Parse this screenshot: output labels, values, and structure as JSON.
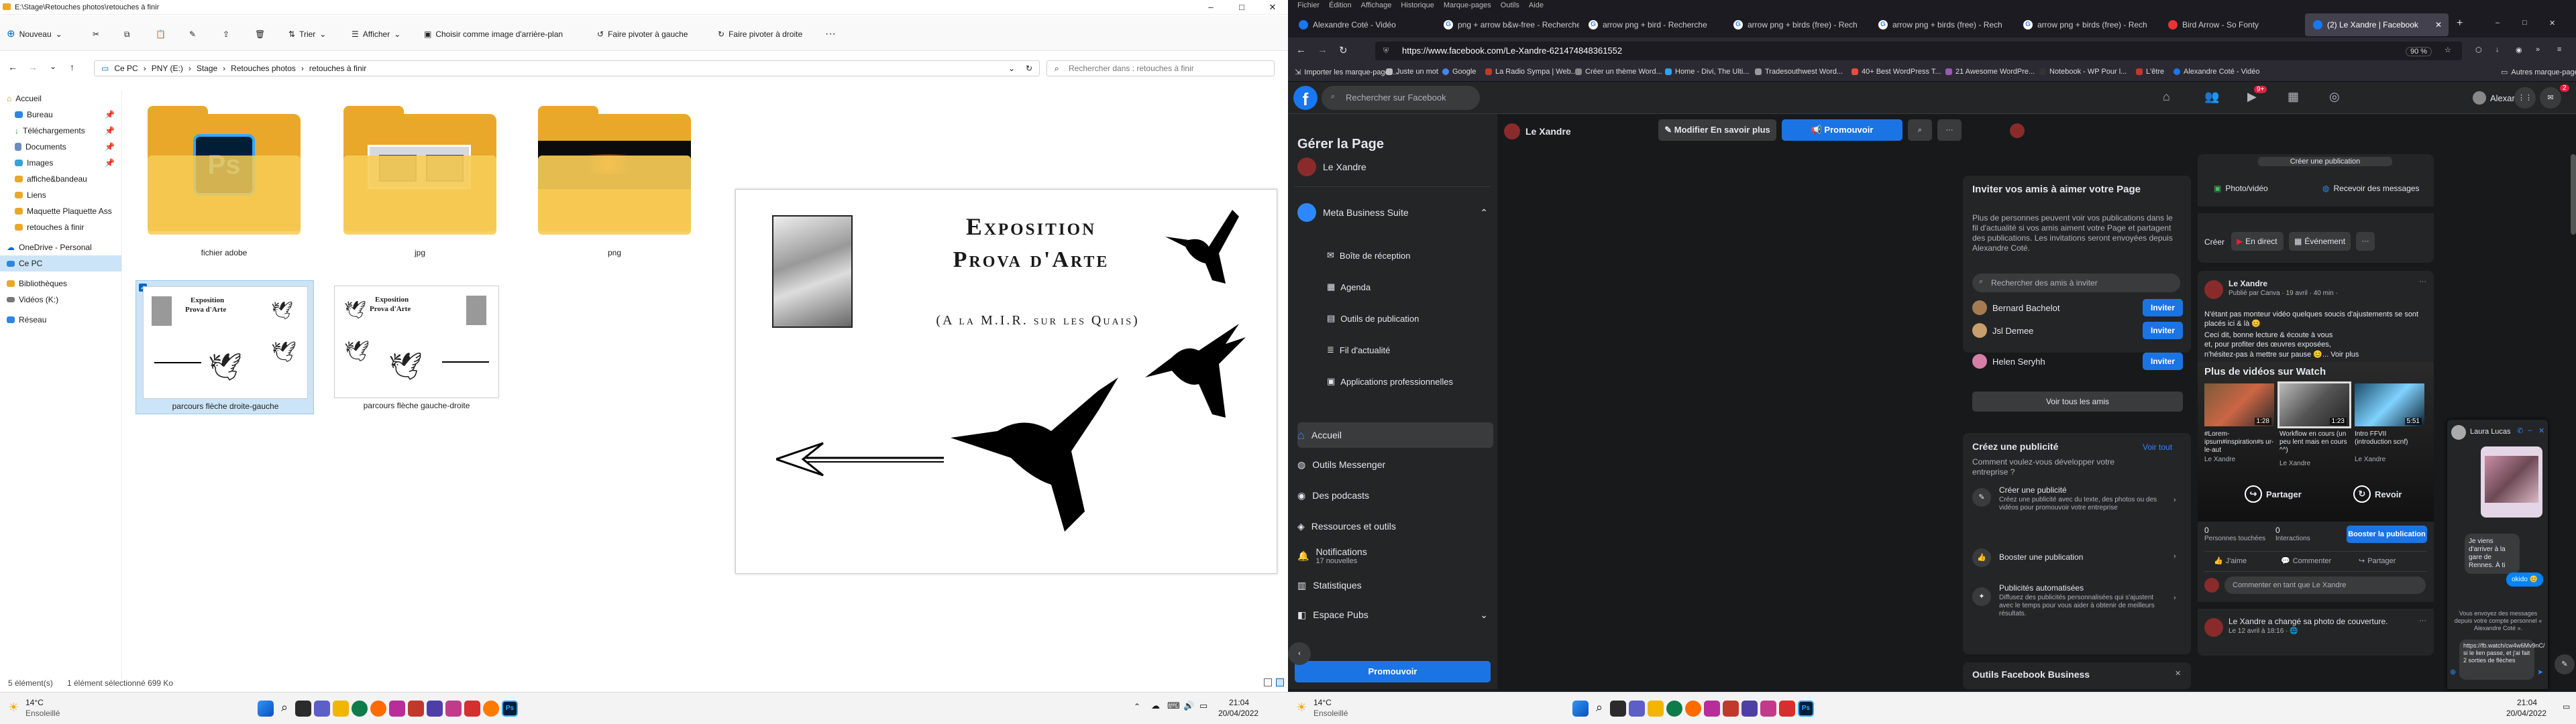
{
  "explorer": {
    "title": "E:\\Stage\\Retouches photos\\retouches à finir",
    "cmd": {
      "new": "Nouveau",
      "sort": "Trier",
      "view": "Afficher",
      "wallpaper": "Choisir comme image d'arrière-plan",
      "rotate_left": "Faire pivoter à gauche",
      "rotate_right": "Faire pivoter à droite",
      "more": "···"
    },
    "breadcrumb": [
      "Ce PC",
      "PNY (E:)",
      "Stage",
      "Retouches photos",
      "retouches à finir"
    ],
    "search_placeholder": "Rechercher dans : retouches à finir",
    "nav": [
      "Accueil",
      "Bureau",
      "Téléchargements",
      "Documents",
      "Images",
      "affiche&bandeau",
      "Liens",
      "Maquette Plaquette Ass",
      "retouches à finir",
      "OneDrive - Personal",
      "Ce PC",
      "Bibliothèques",
      "Vidéos (K:)",
      "Réseau"
    ],
    "items": [
      "fichier adobe",
      "jpg",
      "png",
      "parcours flèche droite-gauche",
      "parcours flèche gauche-droite"
    ],
    "status": {
      "count": "5 élément(s)",
      "selected": "1 élément sélectionné  699 Ko"
    },
    "preview": {
      "title1": "Exposition",
      "title2": "Prova d'Arte",
      "subtitle": "(A la M.I.R. sur les Quais)"
    }
  },
  "taskbar_left": {
    "weather_temp": "14°C",
    "weather_desc": "Ensoleillé",
    "time": "21:04",
    "date": "20/04/2022"
  },
  "taskbar_right": {
    "weather_temp": "14°C",
    "weather_desc": "Ensoleillé",
    "time": "21:04",
    "date": "20/04/2022"
  },
  "firefox": {
    "menu": [
      "Fichier",
      "Édition",
      "Affichage",
      "Historique",
      "Marque-pages",
      "Outils",
      "Aide"
    ],
    "tabs": [
      "Alexandre Coté - Vidéo",
      "png + arrow b&w-free - Recherche",
      "arrow png + bird - Recherche",
      "arrow png + birds (free) - Rech",
      "arrow png + birds (free) - Rech",
      "arrow png + birds (free) - Rech",
      "Bird Arrow - So Fonty",
      "(2) Le Xandre | Facebook"
    ],
    "url": "https://www.facebook.com/Le-Xandre-621474848361552",
    "zoom": "90 %",
    "bookmarks": [
      "Importer les marque-pages...",
      "Juste un mot",
      "Google",
      "La Radio Sympa | Web...",
      "Créer un thème Word...",
      "Home - Divi, The Ulti...",
      "Tradesouthwest Word...",
      "40+ Best WordPress T...",
      "21 Awesome WordPre...",
      "Notebook - WP Pour l...",
      "L'être",
      "Alexandre Coté - Vidéo",
      "Autres marque-pages"
    ]
  },
  "facebook": {
    "search_placeholder": "Rechercher sur Facebook",
    "user": "Alexandre",
    "badges": {
      "watch": "9+",
      "notif": "2"
    },
    "side": {
      "title": "Gérer la Page",
      "page": "Le Xandre",
      "meta": "Meta Business Suite",
      "meta_items": [
        "Boîte de réception",
        "Agenda",
        "Outils de publication",
        "Fil d'actualité",
        "Applications professionnelles"
      ],
      "items": [
        "Accueil",
        "Outils Messenger",
        "Des podcasts",
        "Ressources et outils",
        "Notifications",
        "Statistiques",
        "Espace Pubs"
      ],
      "notif_sub": "17 nouvelles",
      "promote": "Promouvoir"
    },
    "header": {
      "page": "Le Xandre",
      "edit": "Modifier En savoir plus",
      "promote": "Promouvoir"
    },
    "invite": {
      "title": "Inviter vos amis à aimer votre Page",
      "desc": "Plus de personnes peuvent voir vos publications dans le fil d'actualité si vos amis aiment votre Page et partagent des publications. Les invitations seront envoyées depuis Alexandre Coté.",
      "search": "Rechercher des amis à inviter",
      "friends": [
        "Bernard Bachelot",
        "Jsl Demee",
        "Helen Seryhh"
      ],
      "invite_btn": "Inviter",
      "see_all": "Voir tous les amis"
    },
    "ad": {
      "title": "Créez une publicité",
      "see_all": "Voir tout",
      "desc": "Comment voulez-vous développer votre entreprise ?",
      "opt1": "Créer une publicité",
      "opt1_desc": "Créez une publicité avec du texte, des photos ou des vidéos pour promouvoir votre entreprise",
      "opt2": "Booster une publication",
      "opt3": "Publicités automatisées",
      "opt3_desc": "Diffusez des publicités personnalisées qui s'ajustent avec le temps pour vous aider à obtenir de meilleurs résultats.",
      "business": "Outils Facebook Business"
    },
    "feed": {
      "top_label": "Créer une publication",
      "photo": "Photo/vidéo",
      "messages": "Recevoir des messages",
      "create": "Créer",
      "live": "En direct",
      "event": "Événement",
      "post_author": "Le Xandre",
      "post_meta": "Publié par Canva · 19 avril · 40 min ·",
      "post_text1": "N'étant pas monteur vidéo quelques soucis d'ajustements se sont placés ici & là 😊",
      "post_text2": "Ceci dit, bonne lecture & écoute à vous",
      "post_text3": "et, pour profiter des œuvres exposées,",
      "post_text4": "n'hésitez-pas à mettre sur pause 😊... Voir plus",
      "watch_title": "Plus de vidéos sur Watch",
      "videos": [
        {
          "title": "#Lorem-ipsum#inspiration#s ur-le-aut",
          "author": "Le Xandre",
          "dur": "1:28"
        },
        {
          "title": "Workflow en cours (un peu lent mais en cours ^^)",
          "author": "Le Xandre",
          "dur": "1:23"
        },
        {
          "title": "Intro FFVII (introduction scnf)",
          "author": "Le Xandre",
          "dur": "5:51"
        }
      ],
      "share": "Partager",
      "replay": "Revoir",
      "reach": "0",
      "reach_label": "Personnes touchées",
      "engage": "0",
      "engage_label": "Interactions",
      "boost": "Booster la publication",
      "like": "J'aime",
      "comment": "Commenter",
      "share2": "Partager",
      "comment_ph": "Commenter en tant que Le Xandre",
      "post2": "Le Xandre a changé sa photo de couverture.",
      "post2_meta": "Le 12 avril à 18:16 · 🌐"
    },
    "chat": {
      "name": "Laura Lucas",
      "msg1": "Je viens d'arriver à la gare de Rennes. À ti",
      "msg2": "okido 😊",
      "note": "Vous envoyez des messages depuis votre compte personnel « Alexandre Coté ».",
      "draft": "https://fb.watch/cw4w6Mv9nC/ si le lien passe, et j'ai fait 2 sorties de flèches"
    }
  }
}
